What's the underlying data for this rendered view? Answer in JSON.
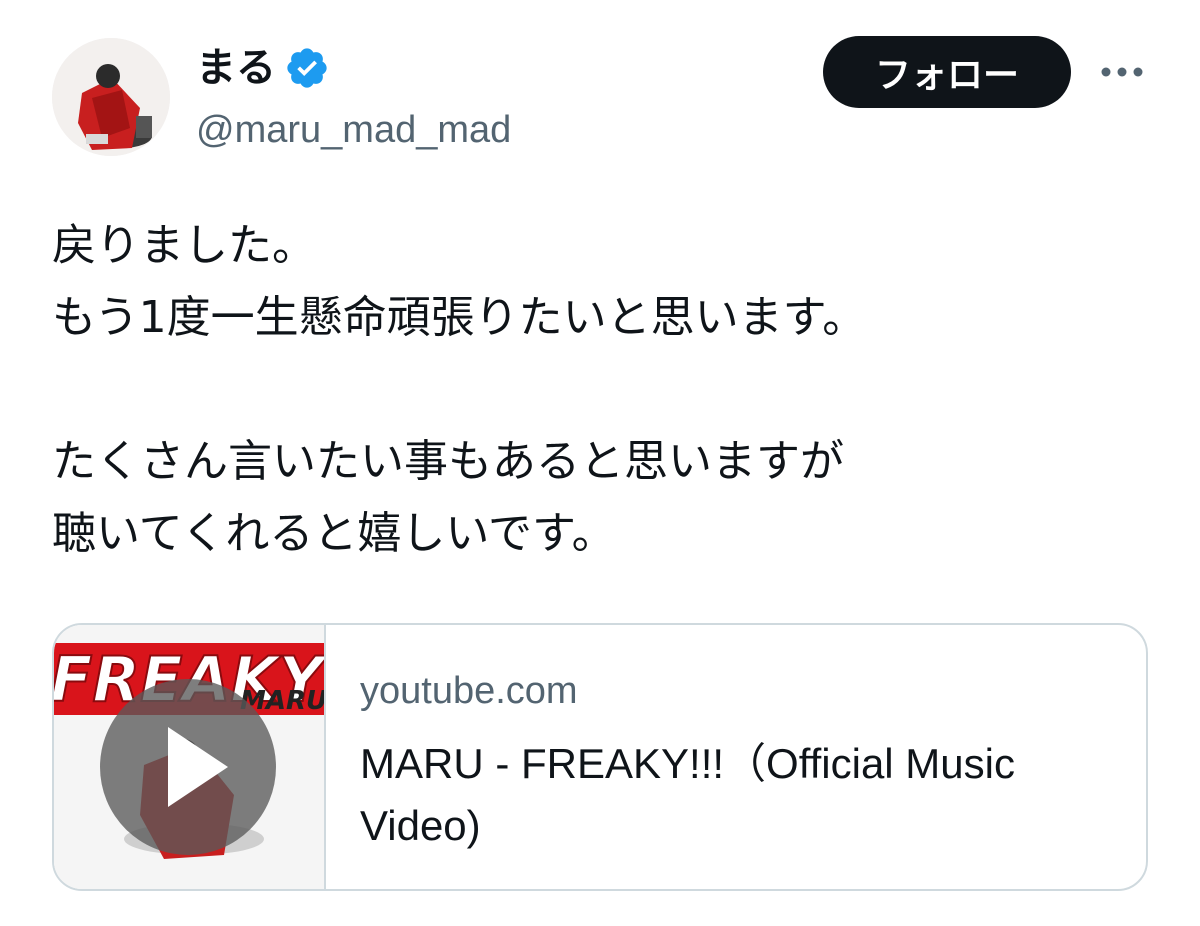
{
  "author": {
    "display_name": "まる",
    "handle": "@maru_mad_mad",
    "verified": true
  },
  "actions": {
    "follow_label": "フォロー",
    "more_icon": "more-icon"
  },
  "tweet": {
    "text": "戻りました。\nもう1度一生懸命頑張りたいと思います。\n\nたくさん言いたい事もあると思いますが\n聴いてくれると嬉しいです。"
  },
  "link_card": {
    "domain": "youtube.com",
    "title": "MARU - FREAKY!!!（Official Music Video)",
    "thumbnail_text": "FREAKY",
    "thumbnail_subtext": "MARU"
  },
  "colors": {
    "text_primary": "#0f1419",
    "text_secondary": "#536471",
    "verified_blue": "#1d9bf0",
    "border": "#cfd9de"
  }
}
